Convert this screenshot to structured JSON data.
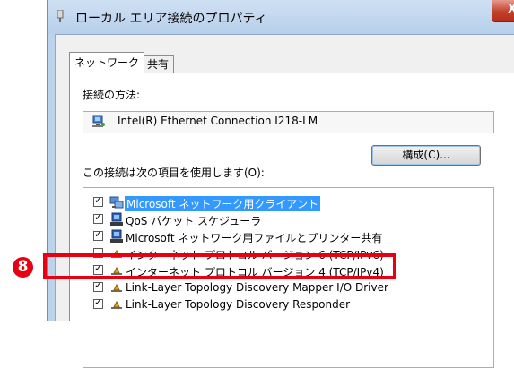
{
  "window": {
    "title": "ローカル エリア接続のプロパティ",
    "close_label": "X"
  },
  "tabs": [
    {
      "label": "ネットワーク",
      "active": true
    },
    {
      "label": "共有",
      "active": false
    }
  ],
  "connect_using": {
    "label": "接続の方法:",
    "adapter_name": "Intel(R) Ethernet Connection I218-LM"
  },
  "configure_button": "構成(C)...",
  "items_label": "この接続は次の項目を使用します(O):",
  "items": [
    {
      "label": "Microsoft ネットワーク用クライアント",
      "checked": true,
      "selected": true,
      "icon": "network-client-icon"
    },
    {
      "label": "QoS パケット スケジューラ",
      "checked": true,
      "selected": false,
      "icon": "service-icon"
    },
    {
      "label": "Microsoft ネットワーク用ファイルとプリンター共有",
      "checked": true,
      "selected": false,
      "icon": "service-icon"
    },
    {
      "label": "インターネット プロトコル バージョン 6 (TCP/IPv6)",
      "checked": false,
      "selected": false,
      "icon": "protocol-icon"
    },
    {
      "label": "インターネット プロトコル バージョン 4 (TCP/IPv4)",
      "checked": true,
      "selected": false,
      "icon": "protocol-icon"
    },
    {
      "label": "Link-Layer Topology Discovery Mapper I/O Driver",
      "checked": true,
      "selected": false,
      "icon": "protocol-icon"
    },
    {
      "label": "Link-Layer Topology Discovery Responder",
      "checked": true,
      "selected": false,
      "icon": "protocol-icon"
    }
  ],
  "annotation": {
    "step_number": "8",
    "color": "#e60012"
  }
}
